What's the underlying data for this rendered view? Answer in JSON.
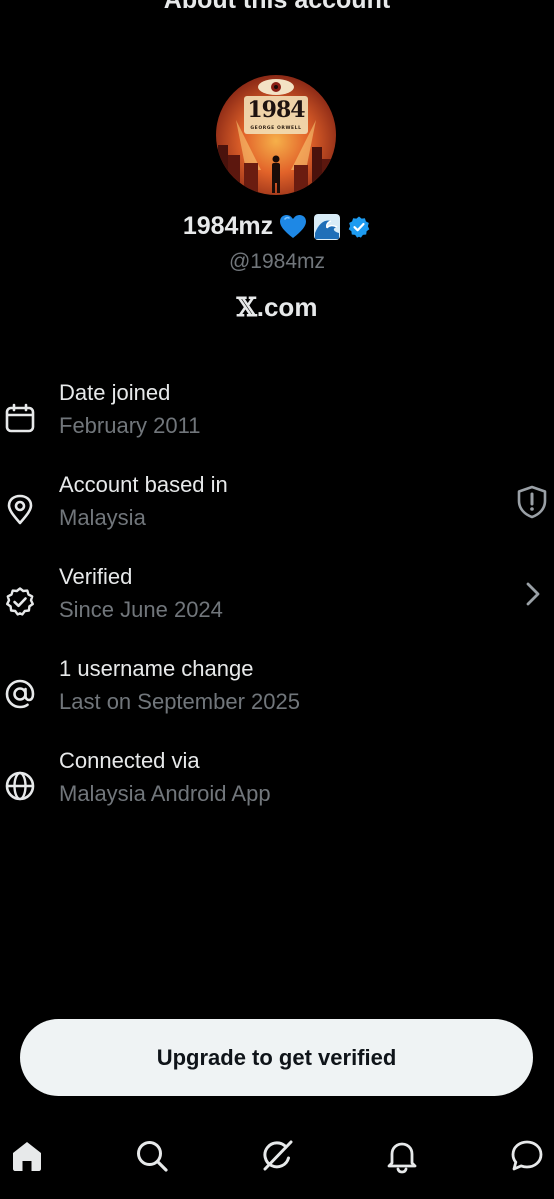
{
  "header": {
    "title": "About this account"
  },
  "profile": {
    "avatar_title": "1984",
    "avatar_subtitle": "GEORGE ORWELL",
    "display_name": "1984mz",
    "name_emojis": [
      "blue-heart-emoji",
      "water-wave-emoji"
    ],
    "verified_badge": "verified-check-icon",
    "handle": "@1984mz",
    "site_prefix": "𝕏",
    "site_suffix": ".com",
    "accent_color": "#1d9bf0"
  },
  "details": [
    {
      "icon": "calendar-icon",
      "label": "Date joined",
      "value": "February 2011"
    },
    {
      "icon": "location-pin-icon",
      "label": "Account based in",
      "value": "Malaysia",
      "trailing_icon": "shield-alert-icon"
    },
    {
      "icon": "verified-badge-icon",
      "label": "Verified",
      "value": "Since June 2024",
      "trailing_icon": "chevron-right-icon"
    },
    {
      "icon": "at-sign-icon",
      "label": "1 username change",
      "value": "Last on September 2025"
    },
    {
      "icon": "globe-icon",
      "label": "Connected via",
      "value": "Malaysia Android App"
    }
  ],
  "cta": {
    "label": "Upgrade to get verified"
  },
  "bottom_nav": [
    {
      "icon": "home-icon",
      "active": true
    },
    {
      "icon": "search-icon",
      "active": false
    },
    {
      "icon": "grok-icon",
      "active": false
    },
    {
      "icon": "bell-icon",
      "active": false
    },
    {
      "icon": "messages-icon",
      "active": false
    }
  ]
}
